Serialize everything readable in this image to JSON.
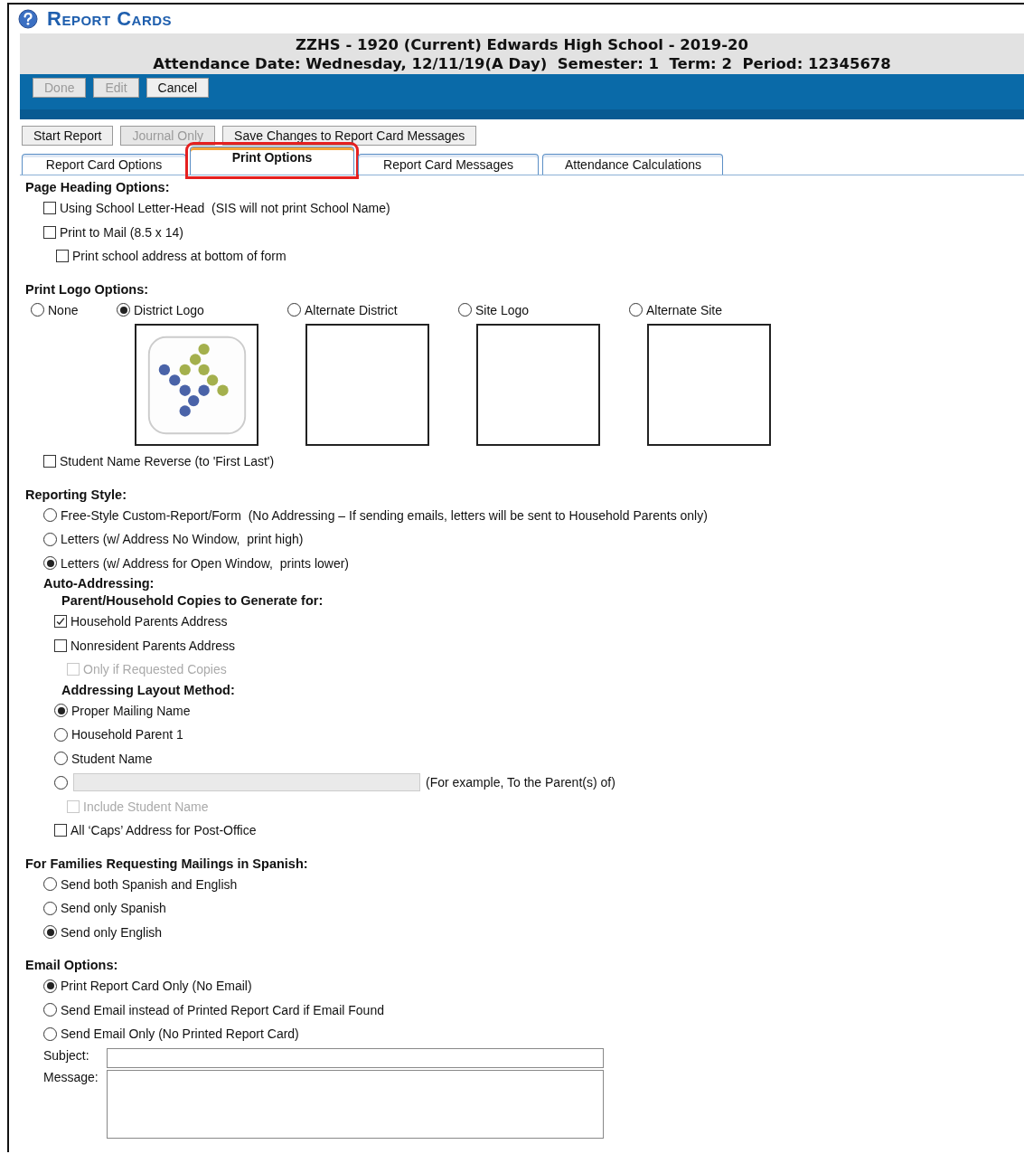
{
  "title": "Report Cards",
  "header": {
    "lines": [
      "ZZHS - 1920 (Current) Edwards High School - 2019-20",
      "Attendance Date: Wednesday, 12/11/19(A Day)  Semester: 1  Term: 2  Period: 12345678"
    ]
  },
  "action_buttons": [
    {
      "label": "Done",
      "disabled": true
    },
    {
      "label": "Edit",
      "disabled": true
    },
    {
      "label": "Cancel",
      "disabled": false
    }
  ],
  "toolbar_buttons": [
    {
      "label": "Start Report",
      "disabled": false
    },
    {
      "label": "Journal Only",
      "disabled": true
    },
    {
      "label": "Save Changes to Report Card Messages",
      "disabled": false
    }
  ],
  "tabs": [
    {
      "label": "Report Card Options",
      "selected": false,
      "highlighted": false
    },
    {
      "label": "Print Options",
      "selected": true,
      "highlighted": true
    },
    {
      "label": "Report Card Messages",
      "selected": false,
      "highlighted": false
    },
    {
      "label": "Attendance Calculations",
      "selected": false,
      "highlighted": false
    }
  ],
  "sections": [
    {
      "heading": "Page Heading Options:",
      "items": [
        {
          "kind": "checkbox",
          "label": "Using School Letter-Head  (SIS will not print School Name)",
          "checked": false,
          "disabled": false
        },
        {
          "kind": "checkbox",
          "label": "Print to Mail (8.5 x 14)",
          "checked": false,
          "disabled": false,
          "children": [
            {
              "kind": "checkbox",
              "label": "Print school address at bottom of form",
              "checked": false,
              "disabled": false
            }
          ]
        }
      ]
    },
    {
      "heading": "Print Logo Options:",
      "items": [
        {
          "kind": "logos",
          "options": [
            {
              "kind": "plain",
              "label": "None",
              "selected": false
            },
            {
              "kind": "logo",
              "label": "District Logo",
              "selected": true
            },
            {
              "kind": "blank",
              "label": "Alternate District",
              "selected": false
            },
            {
              "kind": "blank",
              "label": "Site Logo",
              "selected": false
            },
            {
              "kind": "blank",
              "label": "Alternate Site",
              "selected": false
            }
          ]
        },
        {
          "kind": "checkbox",
          "label": "Student Name Reverse (to 'First Last')",
          "checked": false,
          "disabled": false
        }
      ]
    },
    {
      "heading": "Reporting Style:",
      "items": [
        {
          "kind": "radio",
          "label": "Free-Style Custom-Report/Form  (No Addressing – If sending emails, letters will be sent to Household Parents only)",
          "selected": false
        },
        {
          "kind": "radio",
          "label": "Letters (w/ Address No Window,  print high)",
          "selected": false
        },
        {
          "kind": "radio",
          "label": "Letters (w/ Address for Open Window,  prints lower)",
          "selected": true
        },
        {
          "kind": "subheading",
          "label": "Auto-Addressing:",
          "children": [
            {
              "kind": "subheading",
              "label": "Parent/Household Copies to Generate for:",
              "children": [
                {
                  "kind": "checkbox",
                  "label": "Household Parents Address",
                  "checked": true,
                  "disabled": false
                },
                {
                  "kind": "checkbox",
                  "label": "Nonresident Parents Address",
                  "checked": false,
                  "disabled": false,
                  "children": [
                    {
                      "kind": "checkbox",
                      "label": "Only if Requested Copies",
                      "checked": false,
                      "disabled": true
                    }
                  ]
                }
              ]
            },
            {
              "kind": "subheading",
              "label": "Addressing Layout Method:",
              "children": [
                {
                  "kind": "radio",
                  "label": "Proper Mailing Name",
                  "selected": true
                },
                {
                  "kind": "radio",
                  "label": "Household Parent 1",
                  "selected": false
                },
                {
                  "kind": "radio",
                  "label": "Student Name",
                  "selected": false
                },
                {
                  "kind": "radio-field",
                  "hint": "(For example, To the Parent(s) of)",
                  "selected": false,
                  "disabled": true,
                  "children": [
                    {
                      "kind": "checkbox",
                      "label": "Include Student Name",
                      "checked": false,
                      "disabled": true
                    }
                  ]
                },
                {
                  "kind": "checkbox",
                  "label": "All ‘Caps’ Address for Post-Office",
                  "checked": false,
                  "disabled": false
                }
              ]
            }
          ]
        }
      ]
    },
    {
      "heading": "For Families Requesting Mailings in Spanish:",
      "items": [
        {
          "kind": "radio",
          "label": "Send both Spanish and English",
          "selected": false
        },
        {
          "kind": "radio",
          "label": "Send only Spanish",
          "selected": false
        },
        {
          "kind": "radio",
          "label": "Send only English",
          "selected": true
        }
      ]
    },
    {
      "heading": "Email Options:",
      "items": [
        {
          "kind": "radio",
          "label": "Print Report Card Only (No Email)",
          "selected": true
        },
        {
          "kind": "radio",
          "label": "Send Email instead of Printed Report Card if Email Found",
          "selected": false
        },
        {
          "kind": "radio",
          "label": "Send Email Only (No Printed Report Card)",
          "selected": false
        },
        {
          "kind": "field",
          "label": "Subject:"
        },
        {
          "kind": "textarea",
          "label": "Message:"
        }
      ]
    }
  ]
}
